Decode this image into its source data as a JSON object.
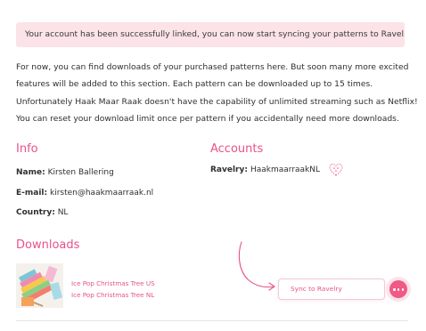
{
  "notice": {
    "text": "Your account has been successfully linked, you can now start syncing your patterns to Ravelry!"
  },
  "intro": {
    "line1": "For now, you can find downloads of your purchased patterns here. But soon many more excited",
    "line2": "features will be added to this section. Each pattern can be downloaded up to 15 times.",
    "line3": "Unfortunately Haak Maar Raak doesn't have the capability of unlimited streaming such as Netflix!",
    "line4": "You can reset your download limit once per pattern if you accidentally need more downloads."
  },
  "info": {
    "title": "Info",
    "name_label": "Name:",
    "name_value": "Kirsten Ballering",
    "email_label": "E-mail:",
    "email_value": "kirsten@haakmaarraak.nl",
    "country_label": "Country:",
    "country_value": "NL"
  },
  "accounts": {
    "title": "Accounts",
    "ravelry_label": "Ravelry:",
    "ravelry_value": "HaakmaarraakNL",
    "status_icon": "heart-icon"
  },
  "downloads": {
    "title": "Downloads",
    "items": [
      {
        "label": "Ice Pop Christmas Tree US"
      },
      {
        "label": "Ice Pop Christmas Tree NL"
      }
    ],
    "sync_button": "Sync to Ravelry"
  },
  "colors": {
    "accent": "#e8528a",
    "notice_bg": "#fbe3e7",
    "chat_bubble": "#ef5a86"
  }
}
